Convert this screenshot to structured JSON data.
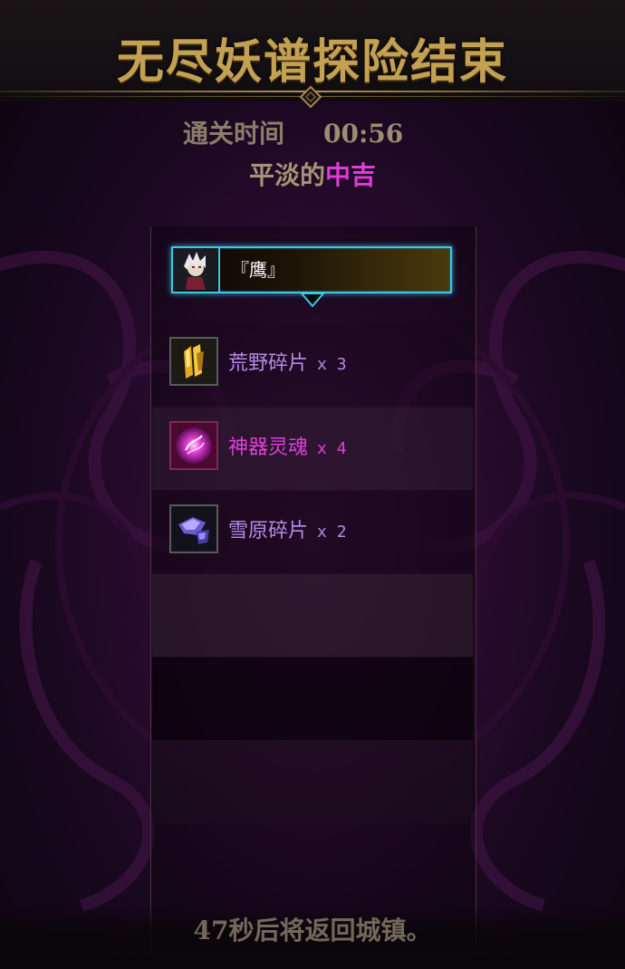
{
  "header": {
    "title": "无尽妖谱探险结束"
  },
  "result": {
    "clear_label": "通关时间",
    "clear_time": "00:56",
    "fortune_prefix": "平淡的",
    "fortune_value": "中吉"
  },
  "player": {
    "name": "『鹰』"
  },
  "rewards": [
    {
      "name": "荒野碎片",
      "qty": "x 3",
      "color": "#b48be6",
      "icon": "gold-crystal-shard-icon"
    },
    {
      "name": "神器灵魂",
      "qty": "x 4",
      "color": "#e040d8",
      "icon": "magenta-soul-orb-icon"
    },
    {
      "name": "雪原碎片",
      "qty": "x 2",
      "color": "#b48be6",
      "icon": "violet-crystal-shard-icon"
    }
  ],
  "footer": {
    "countdown_text": "47秒后将返回城镇。"
  },
  "colors": {
    "title_gold": "#c3a052",
    "fortune_magenta": "#e23bd6",
    "card_border": "#3cc8e6"
  }
}
